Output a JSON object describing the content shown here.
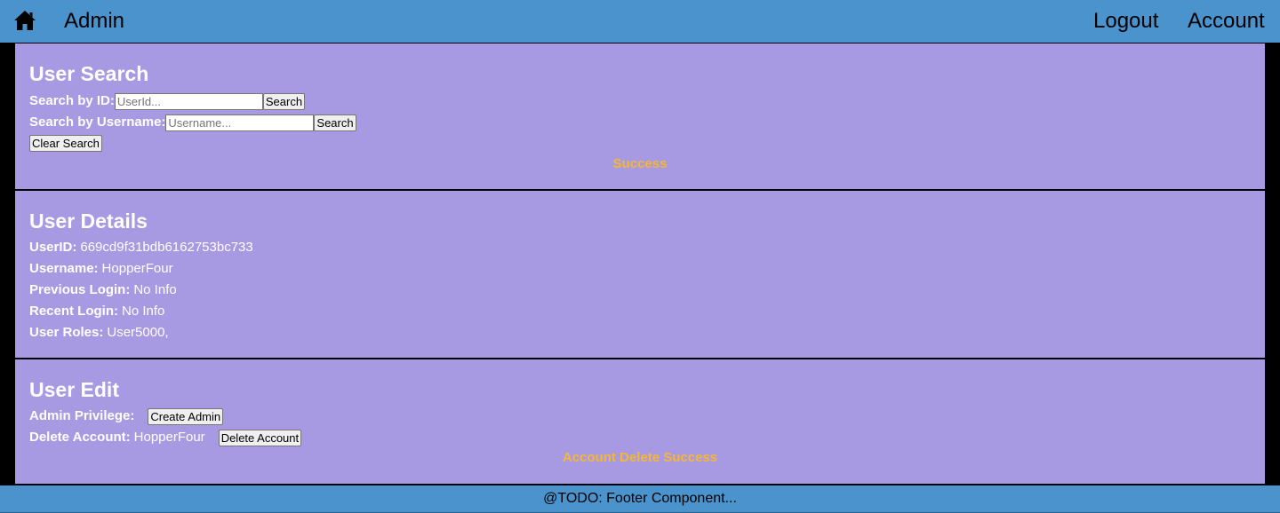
{
  "header": {
    "title": "Admin",
    "home_icon": "home-icon",
    "logout_label": "Logout",
    "account_label": "Account",
    "background_color": "#4b93cc"
  },
  "user_search": {
    "heading": "User Search",
    "by_id_label": "Search by ID:",
    "by_id_placeholder": "UserId...",
    "by_id_value": "",
    "by_username_label": "Search by Username:",
    "by_username_placeholder": "Username...",
    "by_username_value": "",
    "search_label": "Search",
    "clear_label": "Clear Search",
    "status": "Success"
  },
  "user_details": {
    "heading": "User Details",
    "fields": [
      {
        "label": "UserID:",
        "value": "669cd9f31bdb6162753bc733"
      },
      {
        "label": "Username:",
        "value": "HopperFour"
      },
      {
        "label": "Previous Login:",
        "value": "No Info"
      },
      {
        "label": "Recent Login:",
        "value": "No Info"
      },
      {
        "label": "User Roles:",
        "value": "User5000,"
      }
    ]
  },
  "user_edit": {
    "heading": "User Edit",
    "admin_label": "Admin Privilege:",
    "create_admin_label": "Create Admin",
    "delete_label": "Delete Account:",
    "delete_username": "HopperFour",
    "delete_button_label": "Delete Account",
    "status": "Account Delete Success"
  },
  "footer": {
    "text": "@TODO: Footer Component..."
  },
  "colors": {
    "panel": "#a79ae3",
    "status": "#f5b731",
    "frame": "#000000"
  }
}
